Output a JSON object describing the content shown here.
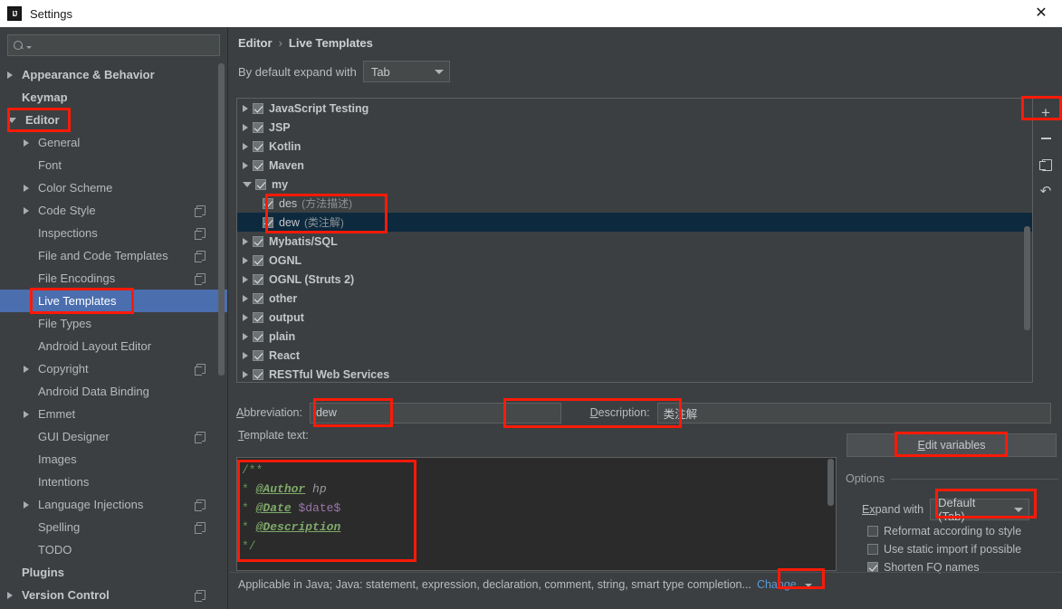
{
  "window": {
    "title": "Settings",
    "logo_text": "IJ",
    "close_icon": "✕"
  },
  "sidebar": {
    "search": {
      "value": "",
      "placeholder": ""
    },
    "items": [
      {
        "label": "Appearance & Behavior",
        "level": 0,
        "arrow": "right",
        "bold": true,
        "copy": false,
        "selected": false
      },
      {
        "label": "Keymap",
        "level": 0,
        "arrow": "none",
        "bold": true,
        "copy": false,
        "selected": false
      },
      {
        "label": "Editor",
        "level": 0,
        "arrow": "down",
        "bold": true,
        "copy": false,
        "selected": false
      },
      {
        "label": "General",
        "level": 1,
        "arrow": "right",
        "bold": false,
        "copy": false,
        "selected": false
      },
      {
        "label": "Font",
        "level": 1,
        "arrow": "none",
        "bold": false,
        "copy": false,
        "selected": false
      },
      {
        "label": "Color Scheme",
        "level": 1,
        "arrow": "right",
        "bold": false,
        "copy": false,
        "selected": false
      },
      {
        "label": "Code Style",
        "level": 1,
        "arrow": "right",
        "bold": false,
        "copy": true,
        "selected": false
      },
      {
        "label": "Inspections",
        "level": 1,
        "arrow": "none",
        "bold": false,
        "copy": true,
        "selected": false
      },
      {
        "label": "File and Code Templates",
        "level": 1,
        "arrow": "none",
        "bold": false,
        "copy": true,
        "selected": false
      },
      {
        "label": "File Encodings",
        "level": 1,
        "arrow": "none",
        "bold": false,
        "copy": true,
        "selected": false
      },
      {
        "label": "Live Templates",
        "level": 1,
        "arrow": "none",
        "bold": false,
        "copy": false,
        "selected": true
      },
      {
        "label": "File Types",
        "level": 1,
        "arrow": "none",
        "bold": false,
        "copy": false,
        "selected": false
      },
      {
        "label": "Android Layout Editor",
        "level": 1,
        "arrow": "none",
        "bold": false,
        "copy": false,
        "selected": false
      },
      {
        "label": "Copyright",
        "level": 1,
        "arrow": "right",
        "bold": false,
        "copy": true,
        "selected": false
      },
      {
        "label": "Android Data Binding",
        "level": 1,
        "arrow": "none",
        "bold": false,
        "copy": false,
        "selected": false
      },
      {
        "label": "Emmet",
        "level": 1,
        "arrow": "right",
        "bold": false,
        "copy": false,
        "selected": false
      },
      {
        "label": "GUI Designer",
        "level": 1,
        "arrow": "none",
        "bold": false,
        "copy": true,
        "selected": false
      },
      {
        "label": "Images",
        "level": 1,
        "arrow": "none",
        "bold": false,
        "copy": false,
        "selected": false
      },
      {
        "label": "Intentions",
        "level": 1,
        "arrow": "none",
        "bold": false,
        "copy": false,
        "selected": false
      },
      {
        "label": "Language Injections",
        "level": 1,
        "arrow": "right",
        "bold": false,
        "copy": true,
        "selected": false
      },
      {
        "label": "Spelling",
        "level": 1,
        "arrow": "none",
        "bold": false,
        "copy": true,
        "selected": false
      },
      {
        "label": "TODO",
        "level": 1,
        "arrow": "none",
        "bold": false,
        "copy": false,
        "selected": false
      },
      {
        "label": "Plugins",
        "level": 0,
        "arrow": "none",
        "bold": true,
        "copy": false,
        "selected": false
      },
      {
        "label": "Version Control",
        "level": 0,
        "arrow": "right",
        "bold": true,
        "copy": true,
        "selected": false
      }
    ]
  },
  "main": {
    "breadcrumb": {
      "parent": "Editor",
      "separator": "›",
      "current": "Live Templates"
    },
    "expand_with": {
      "label": "By default expand with",
      "value": "Tab"
    },
    "tree": [
      {
        "name": "JavaScript Testing",
        "desc": "",
        "arrow": "right",
        "checked": true,
        "leaf": false,
        "selected": false
      },
      {
        "name": "JSP",
        "desc": "",
        "arrow": "right",
        "checked": true,
        "leaf": false,
        "selected": false
      },
      {
        "name": "Kotlin",
        "desc": "",
        "arrow": "right",
        "checked": true,
        "leaf": false,
        "selected": false
      },
      {
        "name": "Maven",
        "desc": "",
        "arrow": "right",
        "checked": true,
        "leaf": false,
        "selected": false
      },
      {
        "name": "my",
        "desc": "",
        "arrow": "down",
        "checked": true,
        "leaf": false,
        "selected": false
      },
      {
        "name": "des",
        "desc": "(方法描述)",
        "arrow": "none",
        "checked": true,
        "leaf": true,
        "selected": false
      },
      {
        "name": "dew",
        "desc": "(类注解)",
        "arrow": "none",
        "checked": true,
        "leaf": true,
        "selected": true
      },
      {
        "name": "Mybatis/SQL",
        "desc": "",
        "arrow": "right",
        "checked": true,
        "leaf": false,
        "selected": false
      },
      {
        "name": "OGNL",
        "desc": "",
        "arrow": "right",
        "checked": true,
        "leaf": false,
        "selected": false
      },
      {
        "name": "OGNL (Struts 2)",
        "desc": "",
        "arrow": "right",
        "checked": true,
        "leaf": false,
        "selected": false
      },
      {
        "name": "other",
        "desc": "",
        "arrow": "right",
        "checked": true,
        "leaf": false,
        "selected": false
      },
      {
        "name": "output",
        "desc": "",
        "arrow": "right",
        "checked": true,
        "leaf": false,
        "selected": false
      },
      {
        "name": "plain",
        "desc": "",
        "arrow": "right",
        "checked": true,
        "leaf": false,
        "selected": false
      },
      {
        "name": "React",
        "desc": "",
        "arrow": "right",
        "checked": true,
        "leaf": false,
        "selected": false
      },
      {
        "name": "RESTful Web Services",
        "desc": "",
        "arrow": "right",
        "checked": true,
        "leaf": false,
        "selected": false
      }
    ],
    "toolbar": {
      "add": "+",
      "remove": "−",
      "duplicate": "duplicate-icon",
      "revert": "↶"
    },
    "abbreviation": {
      "label": "Abbreviation:",
      "mnemonic_pre": "A",
      "mnemonic_post": "bbreviation:",
      "value": "dew"
    },
    "description": {
      "label": "Description:",
      "mnemonic_pre": "D",
      "mnemonic_post": "escription:",
      "value": "类注解"
    },
    "template_text_label": "Template text:",
    "template_text_mnemonic_pre": "T",
    "template_text_mnemonic_post": "emplate text:",
    "editor_lines": {
      "l1": "/**",
      "l2_star": "*",
      "l2_tag": "@Author",
      "l2_val": "hp",
      "l3_star": "*",
      "l3_tag": "@Date",
      "l3_val": "$date$",
      "l4_star": "*",
      "l4_tag": "@Description",
      "l5": "*/"
    },
    "edit_variables": {
      "label": "Edit variables",
      "mnemonic_pre": "E",
      "mnemonic_post": "dit variables"
    },
    "options": {
      "title": "Options",
      "expand_with_label": "Expand with",
      "expand_with_mnemonic_pre": "Ex",
      "expand_with_mnemonic_post": "pand with",
      "expand_with_value": "Default (Tab)",
      "checkboxes": [
        {
          "label": "Reformat according to style",
          "checked": false
        },
        {
          "label": "Use static import if possible",
          "checked": false
        },
        {
          "label": "Shorten FQ names",
          "checked": true
        }
      ]
    },
    "status": {
      "text": "Applicable in Java; Java: statement, expression, declaration, comment, string, smart type completion...",
      "change_link": "Change"
    }
  },
  "colors": {
    "window_bg": "#3c3f41",
    "sidebar_selection": "#4b6eaf",
    "tree_selection": "#0d293e",
    "annotation_red": "#fb1a08",
    "link_blue": "#5b9bd5",
    "editor_bg": "#2b2b2b",
    "code_comment_green": "#629755",
    "code_variable_purple": "#9876aa"
  }
}
